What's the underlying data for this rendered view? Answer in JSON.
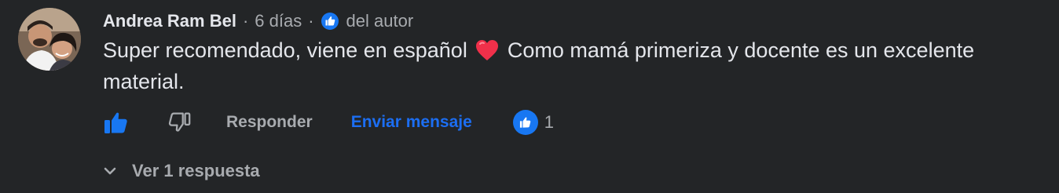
{
  "comment": {
    "author": "Andrea Ram Bel",
    "separator": "·",
    "time": "6 días",
    "author_badge": "del autor",
    "text_before_emoji": "Super recomendado, viene en español",
    "text_after_emoji": " Como mamá primeriza y docente es un excelente material.",
    "emoji": "heart-emoji"
  },
  "actions": {
    "like_icon": "thumbs-up-icon",
    "dislike_icon": "thumbs-down-icon",
    "reply_label": "Responder",
    "message_label": "Enviar mensaje",
    "reaction_icon": "thumbs-up-icon",
    "reaction_count": "1"
  },
  "replies": {
    "label": "Ver 1 respuesta",
    "icon": "chevron-down-icon"
  },
  "colors": {
    "background": "#232527",
    "text": "#e4e6eb",
    "muted": "#a8abaf",
    "accent": "#1877f2",
    "link": "#1c6ef2",
    "heart": "#f0304a"
  }
}
